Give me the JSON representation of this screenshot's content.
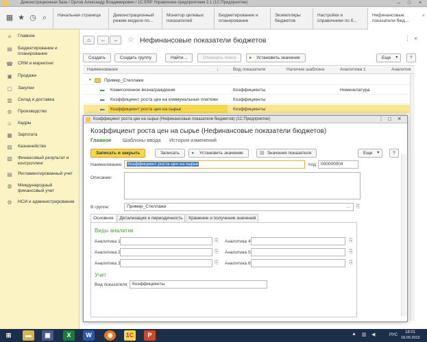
{
  "window": {
    "title": "Демонстрационная база / Орлов Александр Владимирович / 1С:ERP Управление предприятием 2.1  (1С:Предприятие)"
  },
  "top_tabs": [
    {
      "label": "Начальная страница"
    },
    {
      "label": "Демонстрационный режим модели по..."
    },
    {
      "label": "Монитор целевых показателей"
    },
    {
      "label": "Бюджетирование и планирование"
    },
    {
      "label": "Экземпляры бюджетов"
    },
    {
      "label": "Настройки и справочники по б..."
    },
    {
      "label": "Нефинансовые показатели бюд..."
    }
  ],
  "sidebar": {
    "items": [
      {
        "label": "Главное",
        "icon": "menu-icon"
      },
      {
        "label": "Бюджетирование и планирование",
        "icon": "budget-icon"
      },
      {
        "label": "CRM и маркетинг",
        "icon": "crm-icon"
      },
      {
        "label": "Продажи",
        "icon": "sales-icon"
      },
      {
        "label": "Закупки",
        "icon": "purchases-icon"
      },
      {
        "label": "Склад и доставка",
        "icon": "warehouse-icon"
      },
      {
        "label": "Производство",
        "icon": "production-icon"
      },
      {
        "label": "Кадры",
        "icon": "staff-icon"
      },
      {
        "label": "Зарплата",
        "icon": "salary-icon"
      },
      {
        "label": "Казначейство",
        "icon": "treasury-icon"
      },
      {
        "label": "Финансовый результат и контроллинг",
        "icon": "finance-icon"
      },
      {
        "label": "Регламентированный учет",
        "icon": "accounting-icon"
      },
      {
        "label": "Международный финансовый учет",
        "icon": "intl-icon"
      },
      {
        "label": "НСИ и администрирование",
        "icon": "admin-icon"
      }
    ]
  },
  "list_form": {
    "title": "Нефинансовые показатели бюджетов",
    "buttons": {
      "create": "Создать",
      "create_group": "Создать группу",
      "find": "Найти...",
      "cancel_search": "Отменить поиск",
      "set_value": "Установить значение",
      "more": "Еще",
      "help": "?"
    },
    "columns": [
      "Наименование",
      "Вид показателя",
      "Наличие шаблона",
      "Аналитика 1",
      "Аналитик"
    ],
    "rows": [
      {
        "name": "Пример_Стеллажи",
        "kind": "",
        "analytics1": "",
        "type": "group"
      },
      {
        "name": "Комиссионное вознаграждение",
        "kind": "Коэффициенты",
        "analytics1": "Номенклатура",
        "type": "item"
      },
      {
        "name": "Коэффициент роста цен на коммунальные платежи",
        "kind": "Коэффициенты",
        "analytics1": "",
        "type": "item"
      },
      {
        "name": "Коэффициент роста цен на сырье",
        "kind": "Коэффициенты",
        "analytics1": "",
        "type": "selected"
      },
      {
        "name": "",
        "kind": "Коэффициенты",
        "analytics1": "",
        "type": "item"
      }
    ]
  },
  "dialog": {
    "window_title": "Коэффициент роста цен на сырье (Нефинансовые показатели бюджетов)  (1С:Предприятие)",
    "header": "Коэффициент роста цен на сырье (Нефинансовые показатели бюджетов)",
    "nav_links": [
      "Главное",
      "Шаблоны ввода",
      "История изменений"
    ],
    "buttons": {
      "save_close": "Записать и закрыть",
      "save": "Записать",
      "set_value": "Установить значение",
      "indicator_values": "Значения показателя",
      "more": "Еще",
      "help": "?"
    },
    "fields": {
      "name_label": "Наименование:",
      "name_value": "Коэффициент роста цен на сырье",
      "code_label": "Код:",
      "code_value": "000000004",
      "description_label": "Описание:",
      "description_value": "",
      "group_label": "В группе:",
      "group_value": "Пример_Стеллажи"
    },
    "tabs": [
      "Основное",
      "Детализация и периодичность",
      "Хранение и получение значений"
    ],
    "analytics_heading": "Виды аналитик",
    "analytics": [
      "Аналитика 1:",
      "Аналитика 2:",
      "Аналитика 3:",
      "Аналитика 4:",
      "Аналитика 5:",
      "Аналитика 6:"
    ],
    "accounting_heading": "Учет",
    "kind_label": "Вид показателя:",
    "kind_value": "Коэффициенты"
  },
  "taskbar": {
    "lang": "РУС",
    "time": "18:01",
    "date": "18.09.2015"
  },
  "colors": {
    "sidebar_bg": "#fcf3c4",
    "accent_yellow": "#f6d64a",
    "link_green": "#3a8a2a",
    "section_green": "#4aa13a",
    "taskbar": "#1c2f4a"
  }
}
